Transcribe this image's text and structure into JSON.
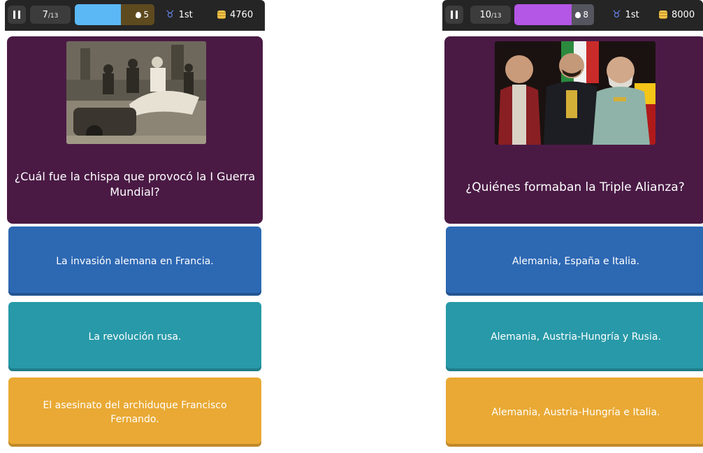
{
  "left": {
    "counter": {
      "current": "7",
      "total": "/13"
    },
    "streak": {
      "value": "5",
      "fill_fraction": 0.58
    },
    "rank": "1st",
    "coins": "4760",
    "question": "¿Cuál fue la chispa que provocó la I Guerra Mundial?",
    "answers": [
      "La invasión alemana en Francia.",
      "La revolución rusa.",
      "El asesinato del archiduque Francisco Fernando."
    ]
  },
  "right": {
    "counter": {
      "current": "10",
      "total": "/13"
    },
    "streak": {
      "value": "8",
      "fill_fraction": 0.72
    },
    "rank": "1st",
    "coins": "8000",
    "question": "¿Quiénes formaban la Triple Alianza?",
    "answers": [
      "Alemania, España e Italia.",
      "Alemania, Austria-Hungría y Rusia.",
      "Alemania, Austria-Hungría e Italia."
    ]
  },
  "colors": {
    "card_bg": "#4a1a45",
    "answer_blue": "#2d68b3",
    "answer_teal": "#2799a8",
    "answer_orange": "#e9a934",
    "streak_left": "#5bb8f5",
    "streak_right": "#b456e6"
  }
}
